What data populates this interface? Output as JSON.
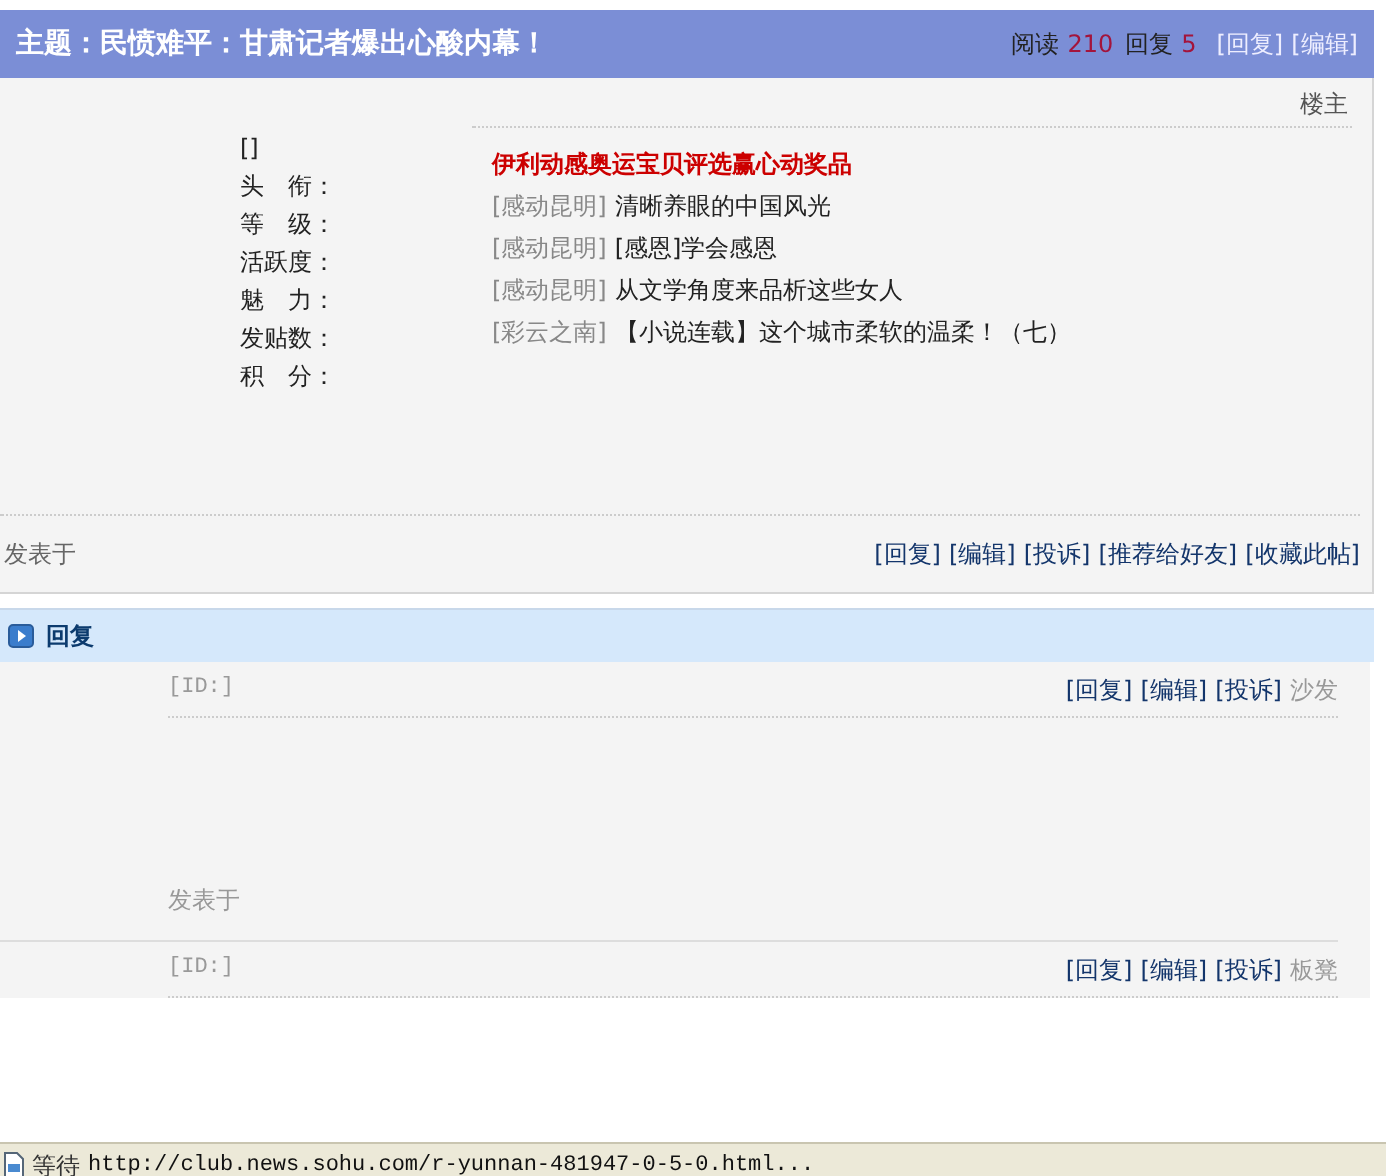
{
  "topic": {
    "title": "主题：民愤难平：甘肃记者爆出心酸内幕！",
    "stats": [
      {
        "label": "阅读",
        "value": "210"
      },
      {
        "label": "回复",
        "value": "5"
      }
    ],
    "actions": [
      "[回复]",
      "[编辑]"
    ]
  },
  "post": {
    "floor": "楼主",
    "author_id": "[]",
    "profile_fields": [
      "头　衔：",
      "等　级：",
      "活跃度：",
      "魅　力：",
      "发贴数：",
      "积　分："
    ],
    "promo": "伊利动感奥运宝贝评选赢心动奖品",
    "links": [
      {
        "tag": "[感动昆明]",
        "title": "清晰养眼的中国风光"
      },
      {
        "tag": "[感动昆明]",
        "title": "[感恩]学会感恩"
      },
      {
        "tag": "[感动昆明]",
        "title": "从文学角度来品析这些女人"
      },
      {
        "tag": "[彩云之南]",
        "title": "【小说连载】这个城市柔软的温柔！（七）"
      }
    ],
    "posted_label": "发表于",
    "actions": [
      "[回复]",
      "[编辑]",
      "[投诉]",
      "[推荐给好友]",
      "[收藏此帖]"
    ]
  },
  "replies_header": "回复",
  "replies": [
    {
      "id": "[ID:]",
      "actions": [
        "[回复]",
        "[编辑]",
        "[投诉]"
      ],
      "floor": "沙发",
      "posted_label": "发表于"
    },
    {
      "id": "[ID:]",
      "actions": [
        "[回复]",
        "[编辑]",
        "[投诉]"
      ],
      "floor": "板凳"
    }
  ],
  "status_bar": {
    "state": "等待",
    "url": "http://club.news.sohu.com/r-yunnan-481947-0-5-0.html..."
  }
}
